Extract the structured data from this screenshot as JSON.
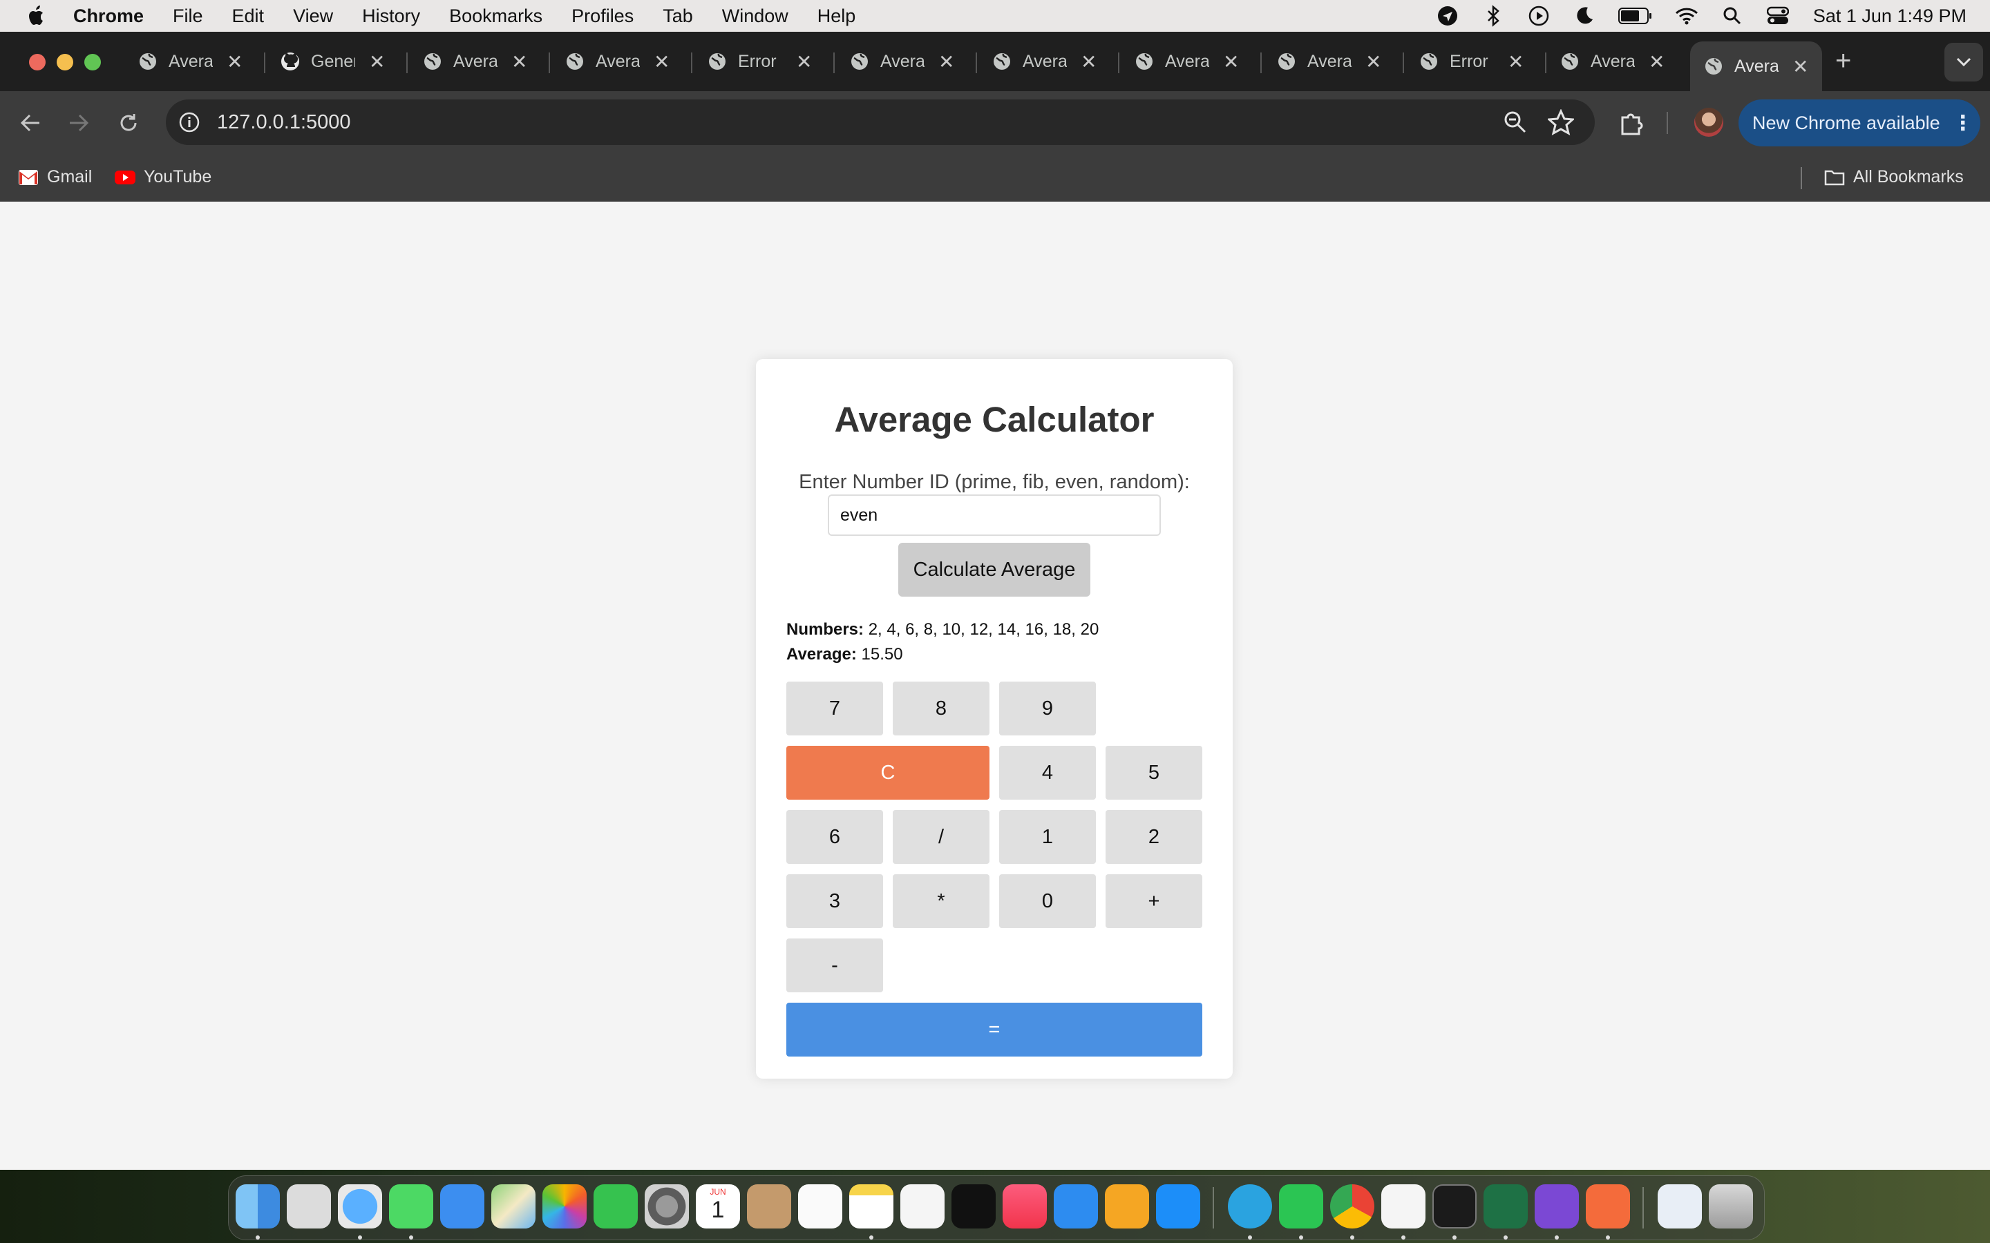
{
  "menubar": {
    "app": "Chrome",
    "items": [
      "File",
      "Edit",
      "View",
      "History",
      "Bookmarks",
      "Profiles",
      "Tab",
      "Window",
      "Help"
    ],
    "clock": "Sat 1 Jun  1:49 PM"
  },
  "tabs": [
    {
      "title": "Avera",
      "icon": "globe-icon"
    },
    {
      "title": "Gener",
      "icon": "github-icon"
    },
    {
      "title": "Avera",
      "icon": "globe-icon"
    },
    {
      "title": "Avera",
      "icon": "globe-icon"
    },
    {
      "title": "Error",
      "icon": "globe-icon"
    },
    {
      "title": "Avera",
      "icon": "globe-icon"
    },
    {
      "title": "Avera",
      "icon": "globe-icon"
    },
    {
      "title": "Avera",
      "icon": "globe-icon"
    },
    {
      "title": "Avera",
      "icon": "globe-icon"
    },
    {
      "title": "Error",
      "icon": "globe-icon"
    },
    {
      "title": "Avera",
      "icon": "globe-icon"
    },
    {
      "title": "Avera",
      "icon": "globe-icon",
      "active": true
    }
  ],
  "toolbar": {
    "url": "127.0.0.1:5000",
    "new_chrome": "New Chrome available"
  },
  "bookmarks": {
    "gmail": "Gmail",
    "youtube": "YouTube",
    "all": "All Bookmarks"
  },
  "page": {
    "title": "Average Calculator",
    "input_label": "Enter Number ID (prime, fib, even, random):",
    "input_value": "even",
    "calc_button": "Calculate Average",
    "numbers_label": "Numbers:",
    "numbers_value": "2, 4, 6, 8, 10, 12, 14, 16, 18, 20",
    "average_label": "Average:",
    "average_value": "15.50",
    "keys": {
      "k7": "7",
      "k8": "8",
      "k9": "9",
      "clear": "C",
      "k4": "4",
      "k5": "5",
      "k6": "6",
      "div": "/",
      "k1": "1",
      "k2": "2",
      "k3": "3",
      "mul": "*",
      "k0": "0",
      "add": "+",
      "sub": "-",
      "equals": "="
    },
    "colors": {
      "clear": "#ef7a4e",
      "equals": "#4a90e2",
      "key": "#e0e0e0"
    }
  },
  "dock": {
    "apps": [
      "Finder",
      "Launchpad",
      "Safari",
      "Messages",
      "Mail",
      "Maps",
      "Photos",
      "FaceTime",
      "System Settings",
      "Calendar",
      "Contacts",
      "Reminders",
      "Notes",
      "Freeform",
      "TV",
      "Music",
      "Keynote",
      "Pages",
      "App Store",
      "Telegram",
      "WhatsApp",
      "Chrome",
      "VS Code",
      "Terminal",
      "Excel",
      "GitHub Desktop",
      "Swift Playgrounds",
      "Python File",
      "Trash"
    ],
    "calendar_month": "JUN",
    "calendar_day": "1"
  }
}
